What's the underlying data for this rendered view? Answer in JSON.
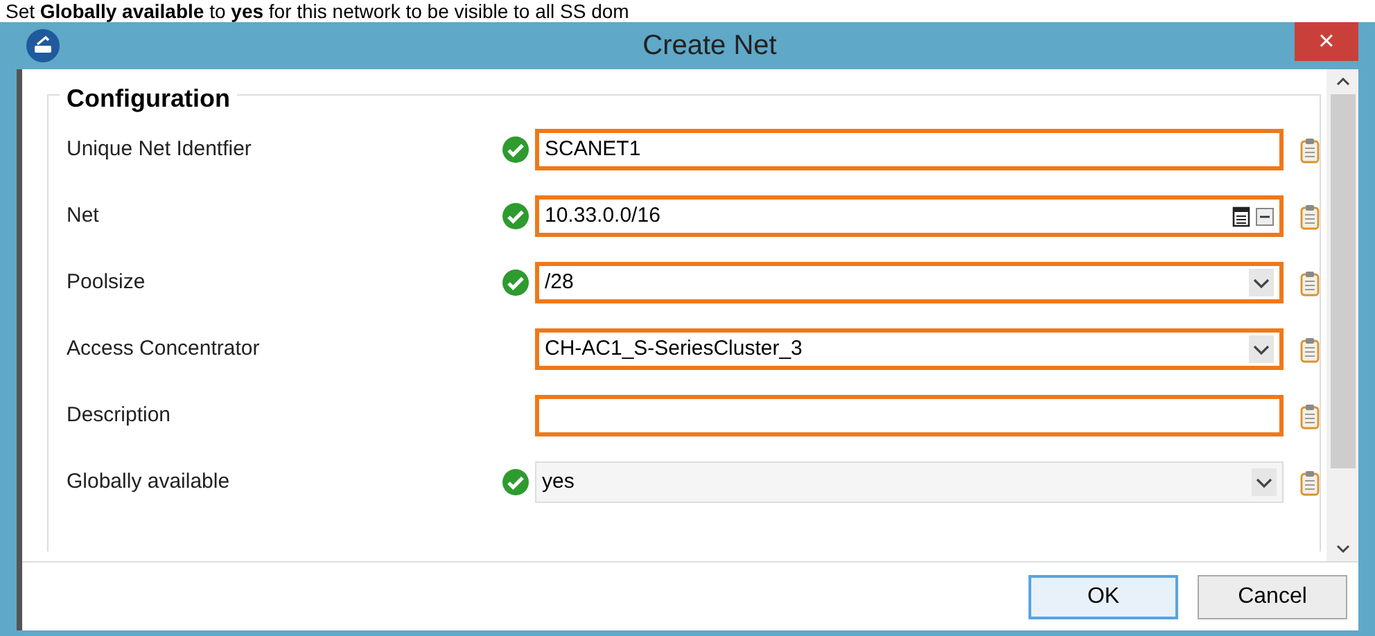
{
  "caption": "Set **Globally available** to **yes** for this network to be visible to all SS dom",
  "window": {
    "title": "Create Net",
    "close": "×"
  },
  "section": {
    "title": "Configuration"
  },
  "fields": [
    {
      "label": "Unique Net Identfier",
      "kind": "text",
      "value": "SCANET1",
      "valid": true,
      "highlighted": true
    },
    {
      "label": "Net",
      "kind": "net",
      "value": "10.33.0.0/16",
      "valid": true,
      "highlighted": true
    },
    {
      "label": "Poolsize",
      "kind": "select",
      "value": "/28",
      "valid": true,
      "highlighted": true
    },
    {
      "label": "Access Concentrator",
      "kind": "select",
      "value": "CH-AC1_S-SeriesCluster_3",
      "valid": false,
      "highlighted": true
    },
    {
      "label": "Description",
      "kind": "text",
      "valid": false,
      "highlighted": true
    },
    {
      "label": "Globally available",
      "kind": "select",
      "value": "yes",
      "valid": true,
      "highlighted": false
    }
  ],
  "buttons": [
    {
      "label": "OK",
      "default": true
    },
    {
      "label": "Cancel",
      "default": false
    }
  ]
}
